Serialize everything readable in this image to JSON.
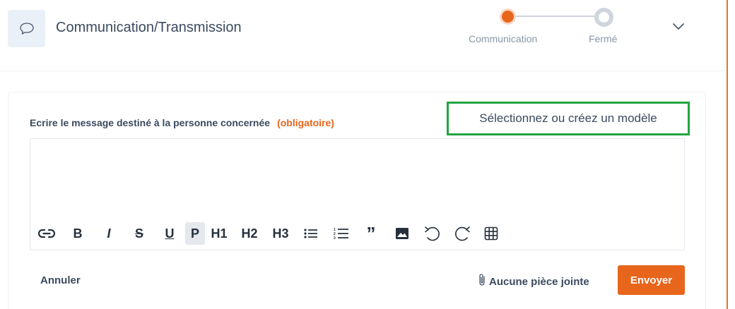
{
  "header": {
    "title": "Communication/Transmission",
    "icon": "chat-bubble-icon"
  },
  "stepper": {
    "steps": [
      {
        "label": "Communication",
        "state": "active",
        "color": "#e8651c"
      },
      {
        "label": "Fermé",
        "state": "pending",
        "color": "#cfd5dd"
      }
    ]
  },
  "form": {
    "message_label": "Ecrire le message destiné à la personne concernée",
    "required_label": "(obligatoire)",
    "template_button": "Sélectionnez ou créez un modèle",
    "editor_value": "",
    "toolbar": {
      "bold": "B",
      "italic": "I",
      "strike": "S",
      "underline": "U",
      "paragraph": "P",
      "h1": "H1",
      "h2": "H2",
      "h3": "H3",
      "quote": "”"
    },
    "cancel_label": "Annuler",
    "attachment_label": "Aucune pièce jointe",
    "send_label": "Envoyer"
  },
  "colors": {
    "accent": "#e8651c",
    "highlight": "#22a444",
    "text": "#3b4a5e"
  }
}
